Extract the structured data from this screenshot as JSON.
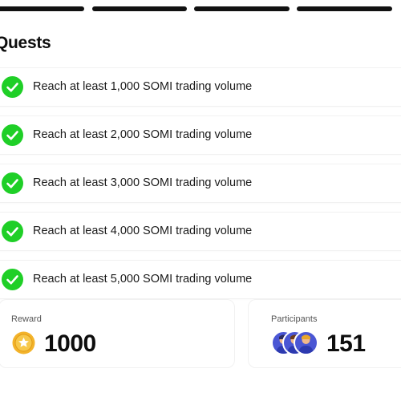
{
  "quests": {
    "title": "Quests",
    "items": [
      {
        "label": "Reach at least 1,000 SOMI trading volume",
        "completed": true
      },
      {
        "label": "Reach at least 2,000 SOMI trading volume",
        "completed": true
      },
      {
        "label": "Reach at least 3,000 SOMI trading volume",
        "completed": true
      },
      {
        "label": "Reach at least 4,000 SOMI trading volume",
        "completed": true
      },
      {
        "label": "Reach at least 5,000 SOMI trading volume",
        "completed": true
      }
    ]
  },
  "reward": {
    "label": "Reward",
    "value": "1000",
    "icon": "star-coin-icon"
  },
  "participants": {
    "label": "Participants",
    "value": "151",
    "avatar_icon": "user-avatar-icon"
  },
  "colors": {
    "check_green": "#1fcf27",
    "coin_gold": "#f3b32a",
    "avatar_blue": "#4a56d4",
    "text_dark": "#0d0d0d"
  }
}
